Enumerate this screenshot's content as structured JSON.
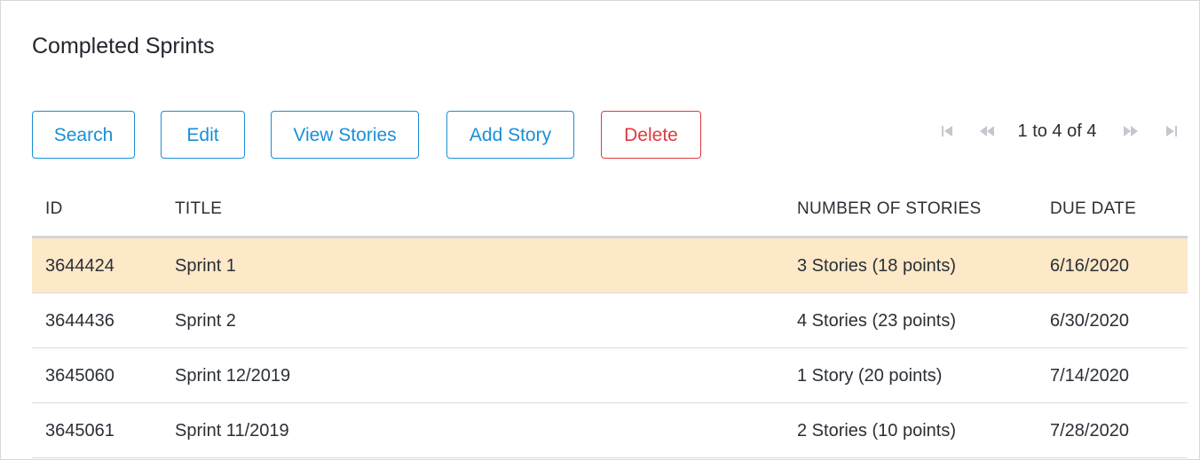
{
  "page": {
    "title": "Completed Sprints"
  },
  "toolbar": {
    "search_label": "Search",
    "edit_label": "Edit",
    "view_stories_label": "View Stories",
    "add_story_label": "Add Story",
    "delete_label": "Delete"
  },
  "pager": {
    "info": "1 to 4 of 4",
    "icons": {
      "first": "first-page-icon",
      "prev": "previous-page-icon",
      "next": "next-page-icon",
      "last": "last-page-icon"
    },
    "icon_color": "#c4c8ce"
  },
  "table": {
    "columns": [
      "ID",
      "TITLE",
      "NUMBER OF STORIES",
      "DUE DATE"
    ],
    "rows": [
      {
        "id": "3644424",
        "title": "Sprint 1",
        "stories": "3 Stories (18 points)",
        "due": "6/16/2020",
        "selected": true
      },
      {
        "id": "3644436",
        "title": "Sprint 2",
        "stories": "4 Stories (23 points)",
        "due": "6/30/2020",
        "selected": false
      },
      {
        "id": "3645060",
        "title": "Sprint 12/2019",
        "stories": "1 Story (20 points)",
        "due": "7/14/2020",
        "selected": false
      },
      {
        "id": "3645061",
        "title": "Sprint 11/2019",
        "stories": "2 Stories (10 points)",
        "due": "7/28/2020",
        "selected": false
      }
    ]
  },
  "colors": {
    "accent": "#1a8fd6",
    "danger": "#e0393e",
    "selected_row": "#fde8c8"
  }
}
